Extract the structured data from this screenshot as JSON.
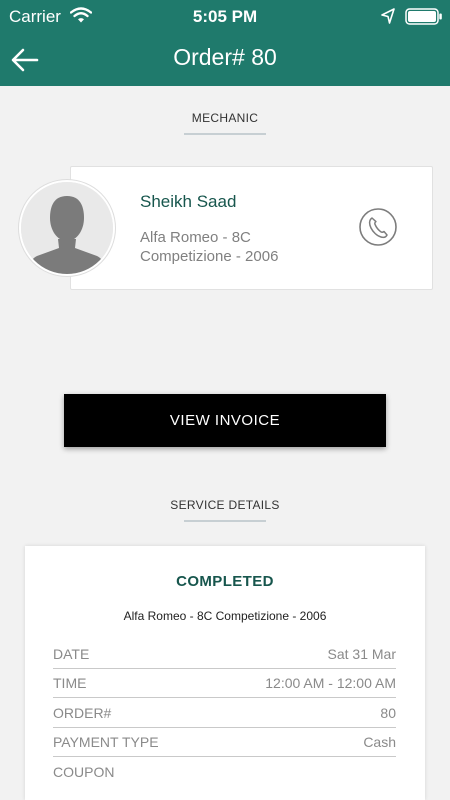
{
  "status_bar": {
    "carrier": "Carrier",
    "time": "5:05 PM",
    "icons": [
      "wifi-icon",
      "location-arrow-icon",
      "battery-icon"
    ]
  },
  "nav": {
    "title": "Order# 80",
    "back_icon": "arrow-left-icon"
  },
  "mechanic": {
    "section_title": "MECHANIC",
    "name": "Sheikh Saad",
    "car_line1": "Alfa Romeo - 8C",
    "car_line2": "Competizione - 2006",
    "avatar_icon": "person-silhouette-icon",
    "call_icon": "phone-icon"
  },
  "invoice_button": {
    "label": "VIEW INVOICE"
  },
  "service": {
    "section_title": "SERVICE DETAILS",
    "status": "COMPLETED",
    "car": "Alfa Romeo - 8C Competizione - 2006",
    "rows": [
      {
        "label": "DATE",
        "value": "Sat 31 Mar"
      },
      {
        "label": "TIME",
        "value": "12:00 AM - 12:00 AM"
      },
      {
        "label": "ORDER#",
        "value": "80"
      },
      {
        "label": "PAYMENT TYPE",
        "value": "Cash"
      },
      {
        "label": "COUPON",
        "value": ""
      }
    ]
  },
  "colors": {
    "header": "#1f7a6c",
    "accent_text": "#17564d",
    "background": "#f2f2f2"
  }
}
